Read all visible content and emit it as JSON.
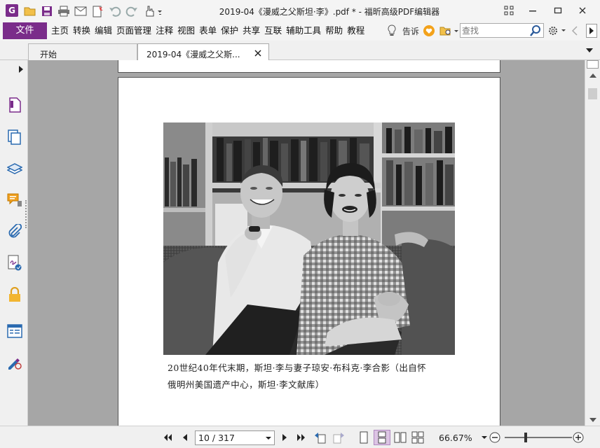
{
  "window": {
    "title": "2019-04《漫威之父斯坦·李》.pdf * - 福昕高级PDF编辑器",
    "app_logo": "G"
  },
  "menu": {
    "file_label": "文件",
    "items": [
      "主页",
      "转换",
      "编辑",
      "页面管理",
      "注释",
      "视图",
      "表单",
      "保护",
      "共享",
      "互联",
      "辅助工具",
      "帮助",
      "教程"
    ],
    "tell_label": "告诉",
    "search_placeholder": "查找"
  },
  "tabs": [
    {
      "label": "开始"
    },
    {
      "label": "2019-04《漫威之父斯..."
    }
  ],
  "document": {
    "caption_line1": "20世纪40年代末期，斯坦·李与妻子琼安·布科克·李合影（出自怀",
    "caption_line2": "俄明州美国遗产中心，斯坦·李文献库）"
  },
  "statusbar": {
    "page_value": "10 / 317",
    "zoom_value": "66.67%"
  },
  "colors": {
    "accent": "#7a2c8a",
    "doc_background": "#a6a6a6"
  }
}
